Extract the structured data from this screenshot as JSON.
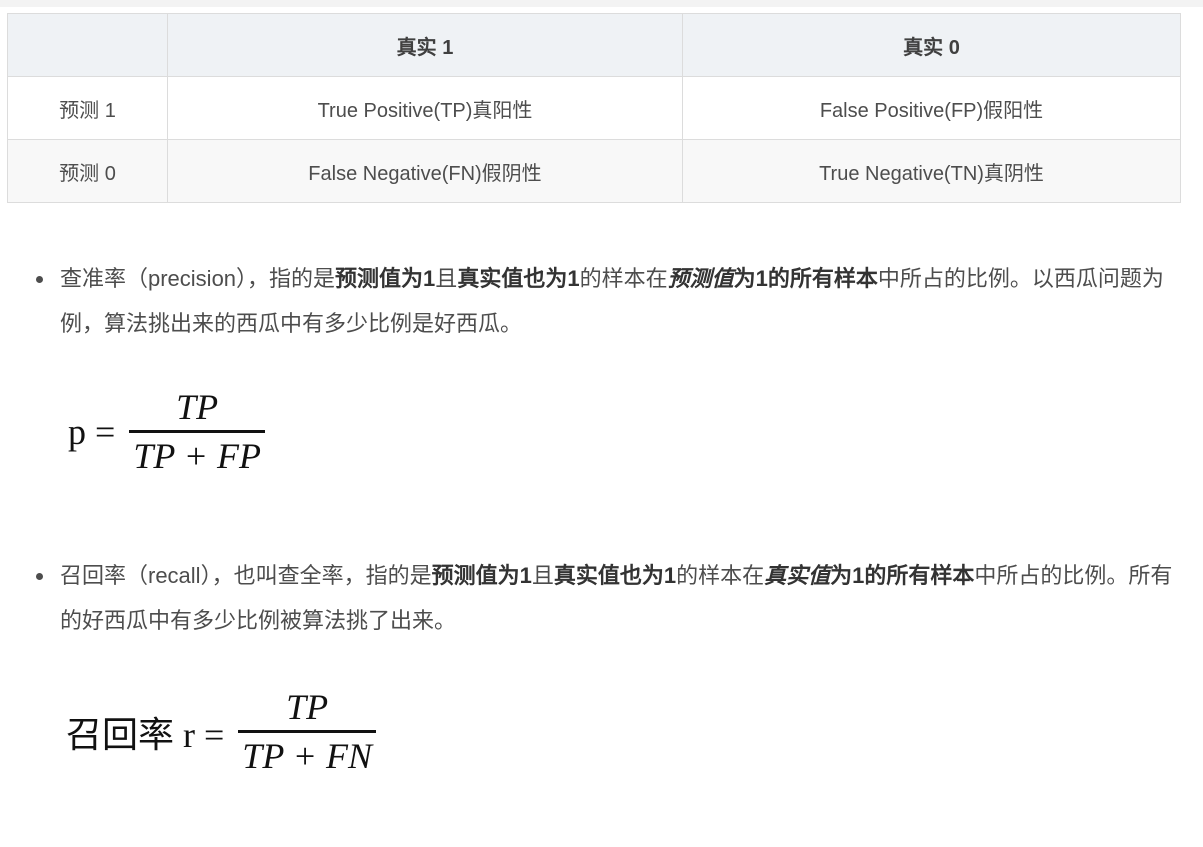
{
  "table": {
    "headers": [
      "",
      "真实 1",
      "真实 0"
    ],
    "rows": [
      [
        "预测 1",
        "True Positive(TP)真阳性",
        "False Positive(FP)假阳性"
      ],
      [
        "预测 0",
        "False Negative(FN)假阴性",
        "True Negative(TN)真阴性"
      ]
    ]
  },
  "precision": {
    "t1": "查准率（precision），指的是",
    "b1": "预测值为1",
    "t2": "且",
    "b2": "真实值也为1",
    "t3": "的样本在",
    "bi": "预测值",
    "b3": "为1的所有样本",
    "t4": "中所占的比例。以西瓜问题为例，算法挑出来的西瓜中有多少比例是好西瓜。",
    "formula": {
      "lhs": "p =",
      "num": "TP",
      "den": "TP + FP"
    }
  },
  "recall": {
    "t1": "召回率（recall），也叫查全率，指的是",
    "b1": "预测值为1",
    "t2": "且",
    "b2": "真实值也为1",
    "t3": "的样本在",
    "bi": "真实值",
    "b3": "为1的所有样本",
    "t4": "中所占的比例。所有的好西瓜中有多少比例被算法挑了出来。",
    "formula": {
      "lhs": "召回率 r =",
      "num": "TP",
      "den": "TP + FN"
    }
  }
}
